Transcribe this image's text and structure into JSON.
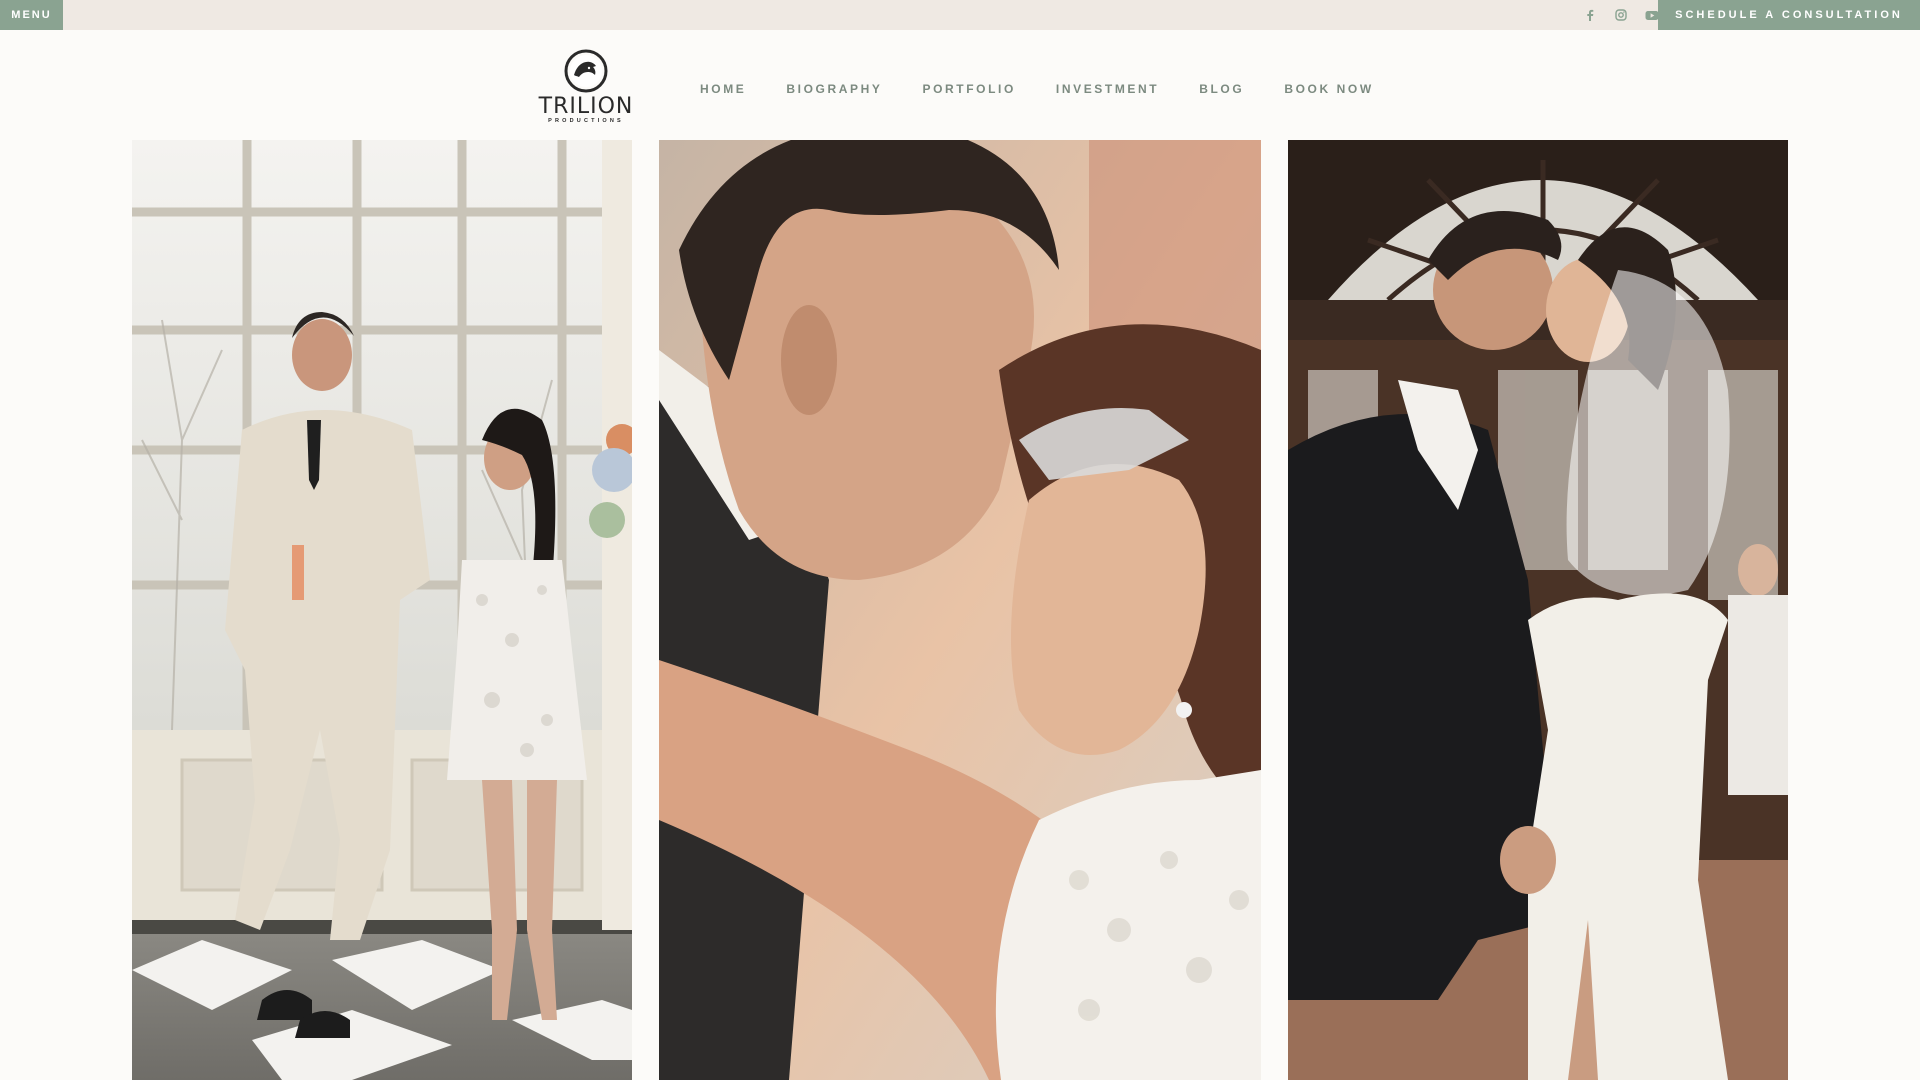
{
  "topbar": {
    "menu_label": "MENU",
    "consult_label": "SCHEDULE A CONSULTATION",
    "socials": [
      {
        "icon": "facebook-icon"
      },
      {
        "icon": "instagram-icon"
      },
      {
        "icon": "youtube-icon"
      }
    ]
  },
  "brand": {
    "name": "TRILION",
    "tagline": "PRODUCTIONS"
  },
  "nav": {
    "items": [
      "HOME",
      "BIOGRAPHY",
      "PORTFOLIO",
      "INVESTMENT",
      "BLOG",
      "BOOK NOW"
    ]
  },
  "gallery": {
    "photos": [
      {
        "subject": "wedding-couple-window"
      },
      {
        "subject": "wedding-couple-closeup"
      },
      {
        "subject": "wedding-couple-kiss"
      }
    ]
  },
  "colors": {
    "accent": "#8aa391",
    "topbar_bg": "#efe9e3",
    "page_bg": "#fcfbf9",
    "nav_text": "#7c8a80"
  }
}
